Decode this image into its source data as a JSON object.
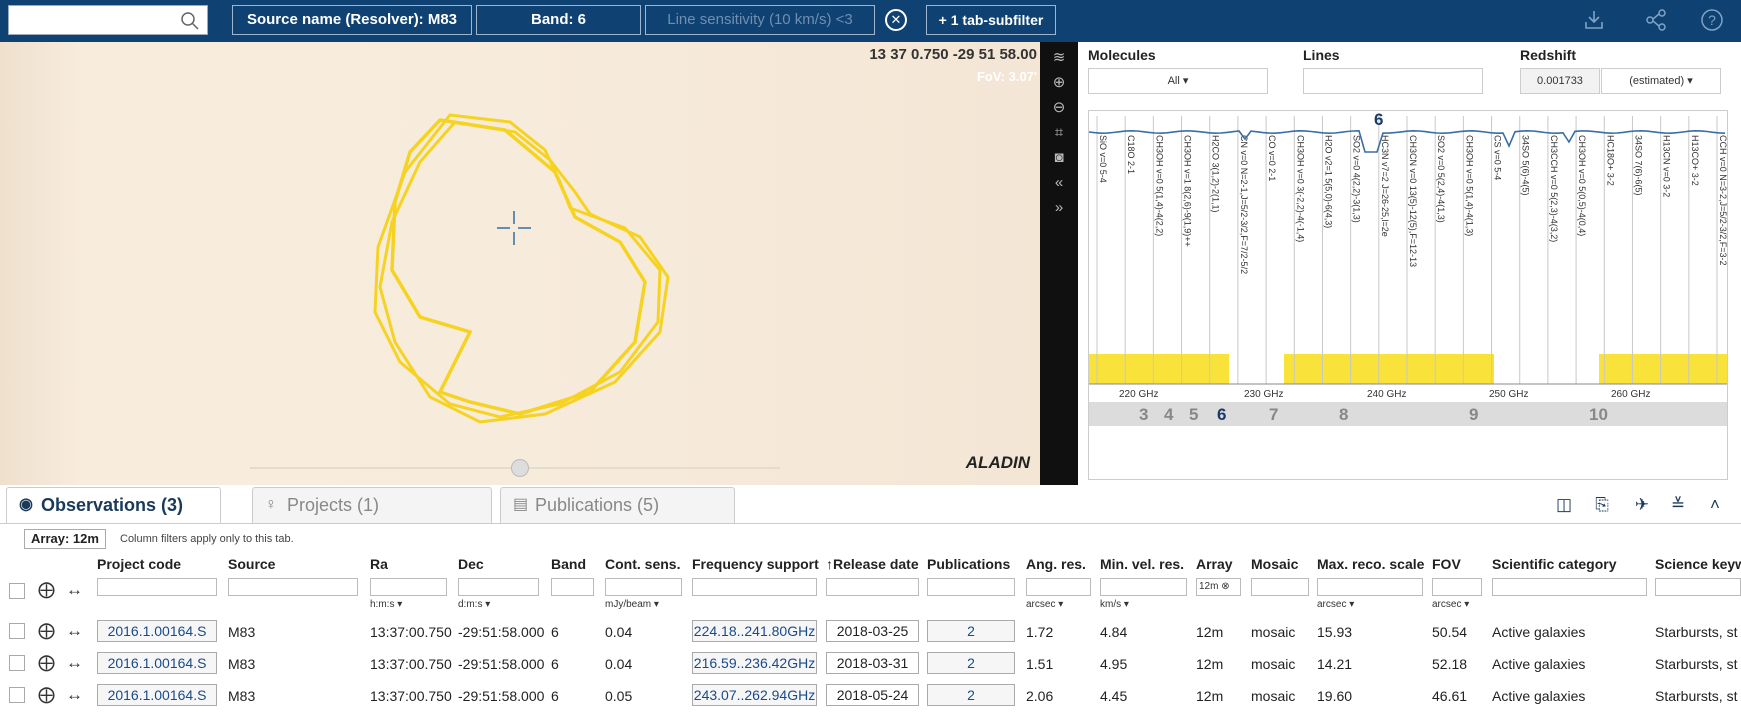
{
  "topbar": {
    "search_placeholder": "",
    "chips": [
      {
        "label": "Source name (Resolver): M83"
      },
      {
        "label": "Band: 6"
      },
      {
        "label": "Line sensitivity (10 km/s) <3"
      },
      {
        "label": "+ 1 tab-subfilter"
      }
    ]
  },
  "map": {
    "coords": "13 37 0.750 -29 51 58.00",
    "fov": "FoV: 3.07'",
    "logo": "ALADIN"
  },
  "spectrum": {
    "molecules_label": "Molecules",
    "molecules_value": "All",
    "lines_label": "Lines",
    "lines_value": "",
    "redshift_label": "Redshift",
    "redshift_value": "0.001733",
    "redshift_mode": "(estimated)",
    "band_marker": "6",
    "freq_ticks": [
      "220 GHz",
      "230 GHz",
      "240 GHz",
      "250 GHz",
      "260 GHz"
    ],
    "band_numbers": [
      "3",
      "4",
      "5",
      "6",
      "7",
      "8",
      "9",
      "10"
    ],
    "lines": [
      "SiO v=0 5-4",
      "C18O 2-1",
      "CH3OH v=0 5(1,4)-4(2,2)",
      "CH3OH v=1 8(2,6)-9(1,9)++",
      "H2CO 3(1,2)-2(1,1)",
      "CN v=0 N=2-1,J=5/2-3/2,F=7/2-5/2",
      "CO v=0 2-1",
      "CH3OH v=0 3(-2,2)-4(-1,4)",
      "H2O v2=1 5(5,0)-6(4,3)",
      "SO2 v=0 4(2,2)-3(1,3)",
      "HC3N v7=2 J=26-25,l=2e",
      "CH3CN v=0 13(5)-12(5),F=12-13",
      "SO2 v=0 5(2,4)-4(1,3)",
      "CH3OH v=0 5(1,4)-4(1,3)",
      "CS v=0 5-4",
      "34SO 5(6)-4(5)",
      "CH3CCH v=0 5(2,3)-4(3,2)",
      "CH3OH v=0 5(0,5)-4(0,4)",
      "HC18O+ 3-2",
      "34SO 7(6)-6(5)",
      "H13CN v=0 3-2",
      "H13CO+ 3-2",
      "CCH v=0 N=3-2,J=5/2-3/2,F=3-2"
    ]
  },
  "tabs": {
    "observations": "Observations (3)",
    "projects": "Projects (1)",
    "publications": "Publications (5)"
  },
  "filter": {
    "array_chip": "Array: 12m",
    "note": "Column filters apply only to this tab.",
    "array_filter_value": "12m"
  },
  "table": {
    "headers": [
      "Project code",
      "Source",
      "Ra",
      "Dec",
      "Band",
      "Cont. sens.",
      "Frequency support",
      "↑Release date",
      "Publications",
      "Ang. res.",
      "Min. vel. res.",
      "Array",
      "Mosaic",
      "Max. reco. scale",
      "FOV",
      "Scientific category",
      "Science keyw"
    ],
    "units": [
      "h:m:s",
      "d:m:s",
      "mJy/beam",
      "arcsec",
      "km/s",
      "arcsec",
      "arcsec"
    ],
    "rows": [
      [
        "2016.1.00164.S",
        "M83",
        "13:37:00.750",
        "-29:51:58.000",
        "6",
        "0.04",
        "224.18..241.80GHz",
        "2018-03-25",
        "2",
        "1.72",
        "4.84",
        "12m",
        "mosaic",
        "15.93",
        "50.54",
        "Active galaxies",
        "Starbursts, st"
      ],
      [
        "2016.1.00164.S",
        "M83",
        "13:37:00.750",
        "-29:51:58.000",
        "6",
        "0.04",
        "216.59..236.42GHz",
        "2018-03-31",
        "2",
        "1.51",
        "4.95",
        "12m",
        "mosaic",
        "14.21",
        "52.18",
        "Active galaxies",
        "Starbursts, st"
      ],
      [
        "2016.1.00164.S",
        "M83",
        "13:37:00.750",
        "-29:51:58.000",
        "6",
        "0.05",
        "243.07..262.94GHz",
        "2018-05-24",
        "2",
        "2.06",
        "4.45",
        "12m",
        "mosaic",
        "19.60",
        "46.61",
        "Active galaxies",
        "Starbursts, st"
      ]
    ]
  },
  "colors": {
    "topbar": "#0f4273",
    "footprint": "#f5d320",
    "band_fill": "#f9e23a",
    "link": "#1a4a8a"
  }
}
